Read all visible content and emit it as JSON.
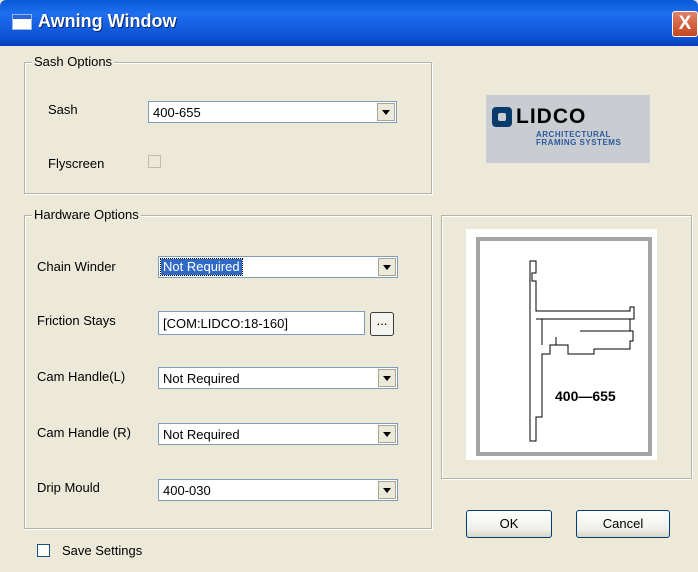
{
  "window": {
    "title": "Awning Window",
    "close_label": "X"
  },
  "sash_options": {
    "group_title": "Sash Options",
    "sash_label": "Sash",
    "sash_value": "400-655",
    "flyscreen_label": "Flyscreen",
    "flyscreen_checked": false
  },
  "hardware_options": {
    "group_title": "Hardware Options",
    "chain_winder_label": "Chain Winder",
    "chain_winder_value": "Not Required",
    "friction_stays_label": "Friction Stays",
    "friction_stays_value": "[COM:LIDCO:18-160]",
    "browse_label": "...",
    "cam_handle_l_label": "Cam Handle(L)",
    "cam_handle_l_value": "Not Required",
    "cam_handle_r_label": "Cam Handle (R)",
    "cam_handle_r_value": "Not Required",
    "drip_mould_label": "Drip Mould",
    "drip_mould_value": "400-030"
  },
  "logo": {
    "wordmark": "LIDCO",
    "tagline": "ARCHITECTURAL FRAMING SYSTEMS"
  },
  "preview": {
    "profile_label": "400—655"
  },
  "footer": {
    "save_settings_label": "Save Settings",
    "save_settings_checked": false,
    "ok_label": "OK",
    "cancel_label": "Cancel"
  },
  "colors": {
    "titlebar": "#0a5ad6",
    "selection": "#316ac5",
    "dialog_bg": "#ece9d8",
    "logo_blue": "#083b6b"
  }
}
